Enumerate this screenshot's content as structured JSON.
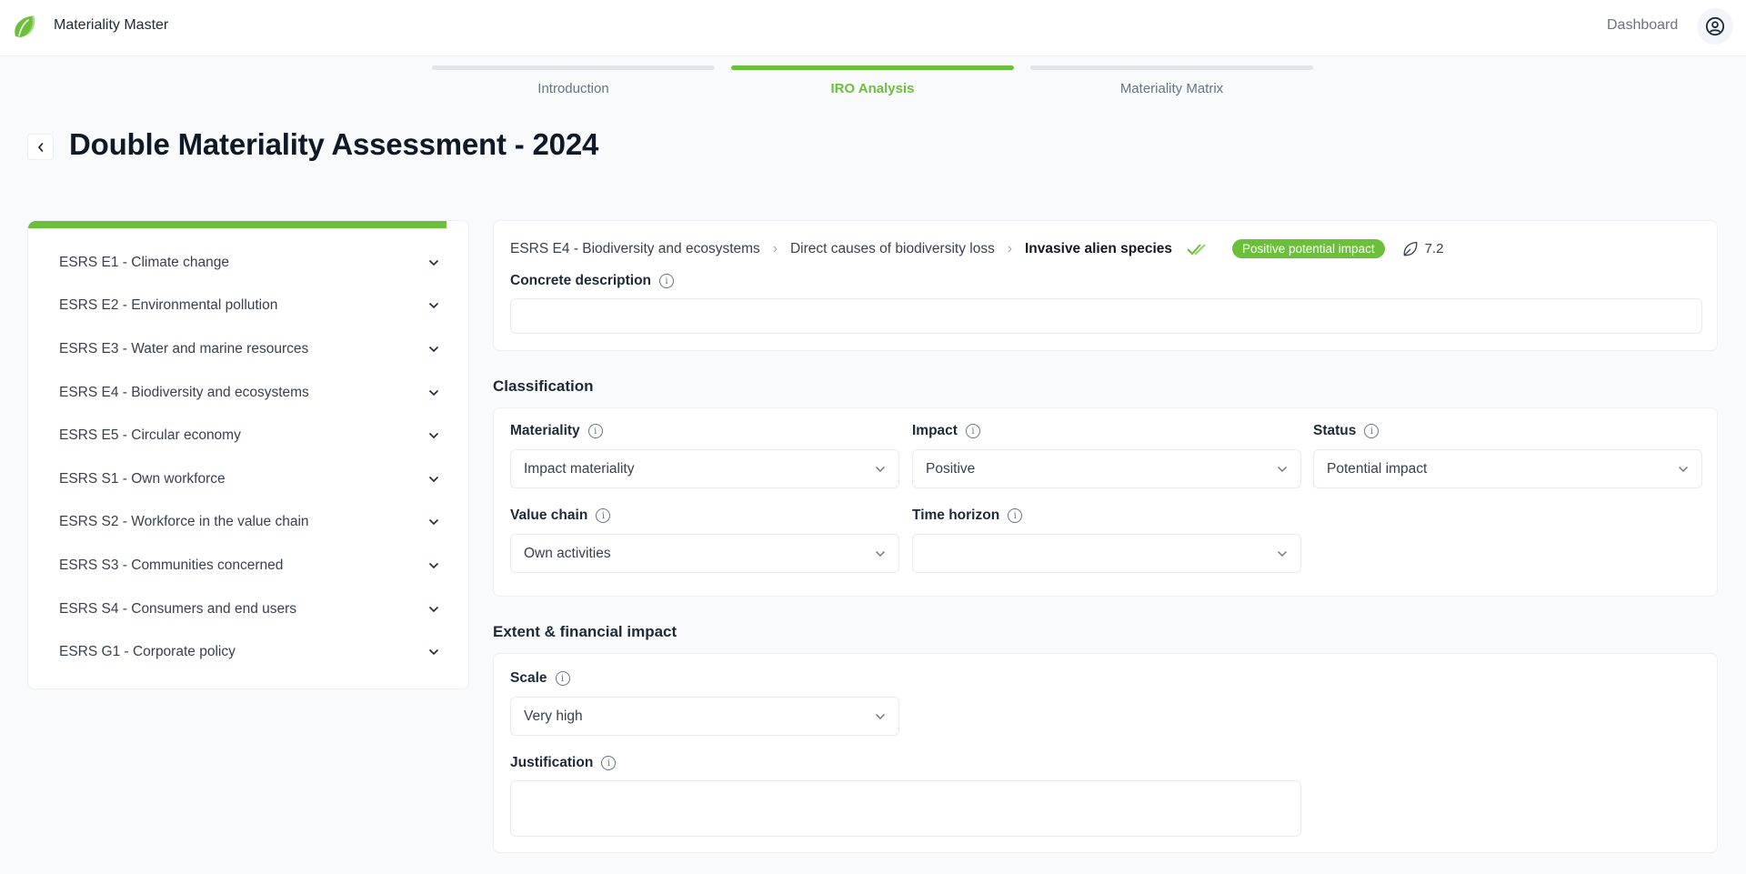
{
  "app": {
    "name": "Materiality Master"
  },
  "header": {
    "dashboard_label": "Dashboard"
  },
  "stepper": [
    {
      "label": "Introduction",
      "active": false
    },
    {
      "label": "IRO Analysis",
      "active": true
    },
    {
      "label": "Materiality Matrix",
      "active": false
    }
  ],
  "page": {
    "title": "Double Materiality Assessment - 2024"
  },
  "sidebar": {
    "progress_fraction": 0.95,
    "items": [
      {
        "label": "ESRS E1 - Climate change"
      },
      {
        "label": "ESRS E2 - Environmental pollution"
      },
      {
        "label": "ESRS E3 - Water and marine resources"
      },
      {
        "label": "ESRS E4 - Biodiversity and ecosystems"
      },
      {
        "label": "ESRS E5 - Circular economy"
      },
      {
        "label": "ESRS S1 - Own workforce"
      },
      {
        "label": "ESRS S2 - Workforce in the value chain"
      },
      {
        "label": "ESRS S3 - Communities concerned"
      },
      {
        "label": "ESRS S4 - Consumers and end users"
      },
      {
        "label": "ESRS G1 - Corporate policy"
      }
    ]
  },
  "detail": {
    "breadcrumb": [
      "ESRS E4 - Biodiversity and ecosystems",
      "Direct causes of biodiversity loss",
      "Invasive alien species"
    ],
    "badge": "Positive potential impact",
    "score": "7.2",
    "colors": {
      "accent": "#6cbf3a"
    },
    "concrete_description": {
      "label": "Concrete description",
      "value": ""
    }
  },
  "classification": {
    "title": "Classification",
    "materiality": {
      "label": "Materiality",
      "value": "Impact materiality"
    },
    "impact": {
      "label": "Impact",
      "value": "Positive"
    },
    "status": {
      "label": "Status",
      "value": "Potential impact"
    },
    "value_chain": {
      "label": "Value chain",
      "value": "Own activities"
    },
    "time_horizon": {
      "label": "Time horizon",
      "value": ""
    }
  },
  "extent": {
    "title": "Extent & financial impact",
    "scale": {
      "label": "Scale",
      "value": "Very high"
    },
    "justification": {
      "label": "Justification",
      "value": ""
    }
  }
}
